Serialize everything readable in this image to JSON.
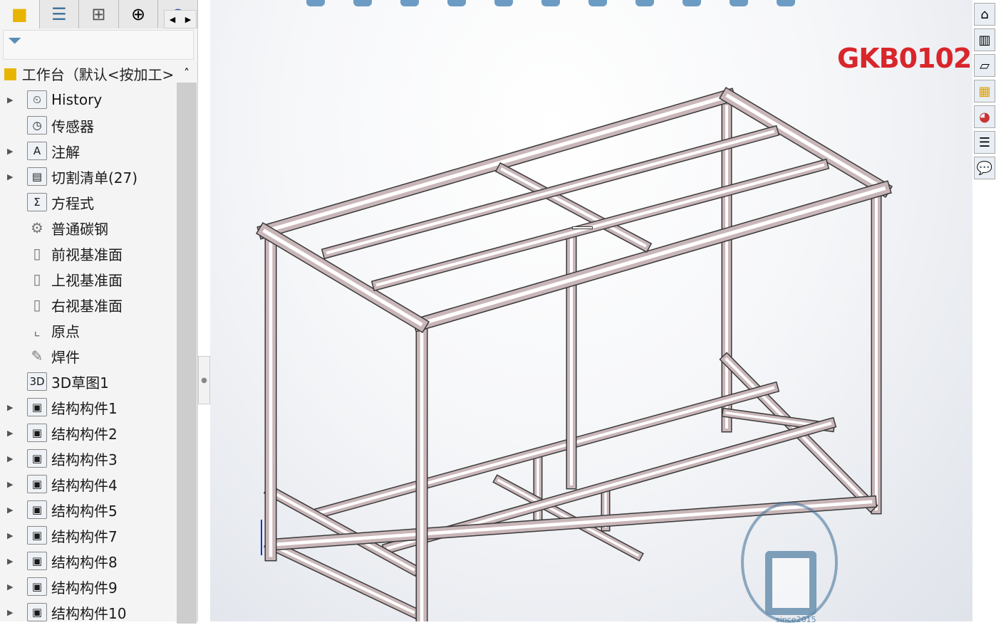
{
  "panel": {
    "tabs": [
      {
        "icon": "part-icon"
      },
      {
        "icon": "feature-manager-icon"
      },
      {
        "icon": "configuration-manager-icon"
      },
      {
        "icon": "dimxpert-icon"
      },
      {
        "icon": "appearance-icon"
      }
    ],
    "root_label": "工作台（默认<按加工>",
    "items": [
      {
        "label": "History",
        "icon": "history-icon",
        "expandable": true
      },
      {
        "label": "传感器",
        "icon": "sensor-icon",
        "expandable": false
      },
      {
        "label": "注解",
        "icon": "annotation-icon",
        "expandable": true
      },
      {
        "label": "切割清单(27)",
        "icon": "cut-list-icon",
        "expandable": true
      },
      {
        "label": "方程式",
        "icon": "equation-icon",
        "expandable": false
      },
      {
        "label": "普通碳钢",
        "icon": "material-icon",
        "expandable": false
      },
      {
        "label": "前视基准面",
        "icon": "plane-icon",
        "expandable": false
      },
      {
        "label": "上视基准面",
        "icon": "plane-icon",
        "expandable": false
      },
      {
        "label": "右视基准面",
        "icon": "plane-icon",
        "expandable": false
      },
      {
        "label": "原点",
        "icon": "origin-icon",
        "expandable": false
      },
      {
        "label": "焊件",
        "icon": "weldment-icon",
        "expandable": false
      },
      {
        "label": "3D草图1",
        "icon": "3d-sketch-icon",
        "expandable": false
      },
      {
        "label": "结构构件1",
        "icon": "structural-member-icon",
        "expandable": true
      },
      {
        "label": "结构构件2",
        "icon": "structural-member-icon",
        "expandable": true
      },
      {
        "label": "结构构件3",
        "icon": "structural-member-icon",
        "expandable": true
      },
      {
        "label": "结构构件4",
        "icon": "structural-member-icon",
        "expandable": true
      },
      {
        "label": "结构构件5",
        "icon": "structural-member-icon",
        "expandable": true
      },
      {
        "label": "结构构件7",
        "icon": "structural-member-icon",
        "expandable": true
      },
      {
        "label": "结构构件8",
        "icon": "structural-member-icon",
        "expandable": true
      },
      {
        "label": "结构构件9",
        "icon": "structural-member-icon",
        "expandable": true
      },
      {
        "label": "结构构件10",
        "icon": "structural-member-icon",
        "expandable": true
      }
    ]
  },
  "viewport": {
    "model_code": "GKB0102",
    "watermark": "since2015",
    "code_color": "#d8262b",
    "member_color": "#c9b6b9"
  }
}
